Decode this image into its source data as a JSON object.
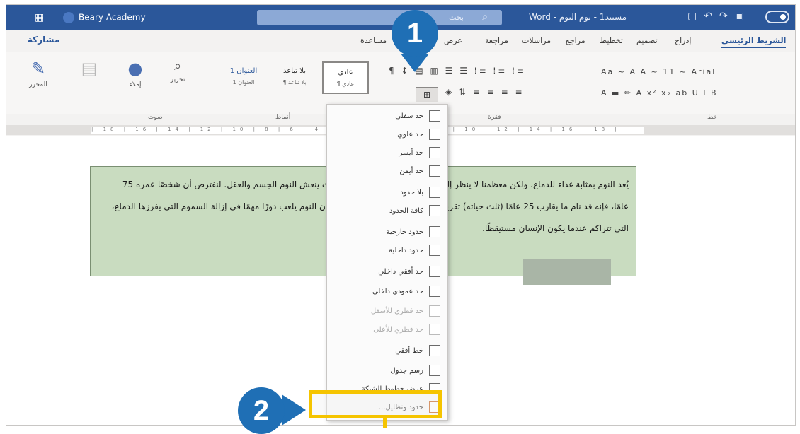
{
  "titlebar": {
    "brand": "Beary Academy",
    "search_text": "بحث",
    "doc_title": "Word - مستند1 - نوم النوم"
  },
  "tabs": {
    "share": "مشاركة",
    "items": [
      "مساعدة",
      "عرض",
      "مراجعة",
      "مراسلات",
      "مراجع",
      "تخطيط",
      "تصميم",
      "إدراج",
      "الشريط الرئيسي"
    ]
  },
  "ribbon": {
    "editor_label": "المحرر",
    "dictate_label": "إملاء",
    "find_label": "تحرير",
    "styles": [
      {
        "name": "عادي",
        "sub": "¶ عادي"
      },
      {
        "name": "بلا تباعد",
        "sub": "¶ بلا تباعد"
      },
      {
        "name": "العنوان 1",
        "sub": "العنوان 1"
      }
    ],
    "font_row": "Aa ~ A A ~ 11 ~ Arial",
    "para_label": "فقرة",
    "font_label": "خط",
    "styles_label": "أنماط"
  },
  "document": {
    "text": "يُعد النوم بمثابة غذاء للدماغ، ولكن معظمنا لا ينظر إليه بوصفه ضروريًا لحياة صحية، حيث ينعش النوم الجسم والعقل. لنفترض أن شخصًا عمره 75 عامًا، فإنه قد نام ما يقارب 25 عامًا (ثلث حياته) تقريبًا. تشير نتائج الأبحاث الحديثة إلى أن النوم يلعب دورًا مهمًا في إزالة السموم التي يفرزها الدماغ، التي تتراكم عندما يكون الإنسان مستيقظًا."
  },
  "dropdown": {
    "items": [
      {
        "label": "حد سفلي",
        "dim": false
      },
      {
        "label": "حد علوي",
        "dim": false
      },
      {
        "label": "حد أيسر",
        "dim": false
      },
      {
        "label": "حد أيمن",
        "dim": false
      },
      {
        "label": "بلا حدود",
        "dim": false
      },
      {
        "label": "كافة الحدود",
        "dim": false
      },
      {
        "label": "حدود خارجية",
        "dim": false
      },
      {
        "label": "حدود داخلية",
        "dim": false
      },
      {
        "label": "حد أفقي داخلي",
        "dim": false
      },
      {
        "label": "حد عمودي داخلي",
        "dim": false
      },
      {
        "label": "حد قطري للأسفل",
        "dim": true
      },
      {
        "label": "حد قطري للأعلى",
        "dim": true
      },
      {
        "label": "خط أفقي",
        "dim": false
      },
      {
        "label": "رسم جدول",
        "dim": false
      },
      {
        "label": "عرض خطوط الشبكة",
        "dim": false
      },
      {
        "label": "حدود وتظليل...",
        "dim": false
      }
    ]
  },
  "callouts": {
    "one": "1",
    "two": "2"
  },
  "colors": {
    "accent": "#2b579a",
    "callout": "#1f6fb5",
    "highlight": "#f5c400",
    "textbox_fill": "#c9dcc0"
  }
}
